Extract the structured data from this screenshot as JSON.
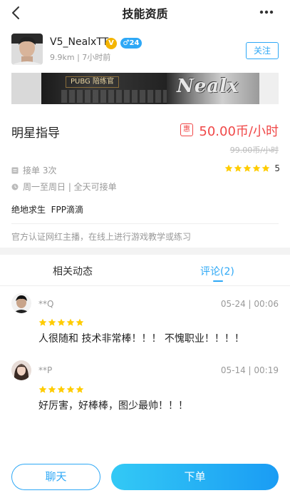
{
  "header": {
    "title": "技能资质",
    "back_icon": "chevron-left-icon",
    "more_icon": "more-dots-icon"
  },
  "profile": {
    "username": "V5_NealxTT",
    "verified_badge": "V",
    "gender_age": "♂24",
    "meta": "9.9km | 7小时前",
    "follow_label": "关注"
  },
  "banner": {
    "tag": "PUBG 陪练官",
    "logo_text": "Nealx"
  },
  "skill": {
    "name": "明星指导",
    "discount_badge": "惠",
    "price": "50.00币/小时",
    "original_price": "99.00币/小时",
    "orders": "接单 3次",
    "rating": "5",
    "rating_stars": 5,
    "schedule": "周一至周日 | 全天可接单",
    "tags": "绝地求生  FPP滴滴",
    "description": "官方认证网红主播，在线上进行游戏教学或练习"
  },
  "tabs": [
    {
      "label": "相关动态",
      "active": false
    },
    {
      "label": "评论(2)",
      "active": true
    }
  ],
  "comments": [
    {
      "user": "**Q",
      "time": "05-24 | 00:06",
      "stars": 5,
      "text": "人很随和 技术非常棒！！！ 不愧职业！！！！"
    },
    {
      "user": "**P",
      "time": "05-14 | 00:19",
      "stars": 5,
      "text": "好厉害，好棒棒，图少最帅！！！"
    }
  ],
  "actions": {
    "chat_label": "聊天",
    "order_label": "下单"
  },
  "colors": {
    "accent": "#2ea8f6",
    "price": "#f04848",
    "star": "#ffcc00"
  }
}
